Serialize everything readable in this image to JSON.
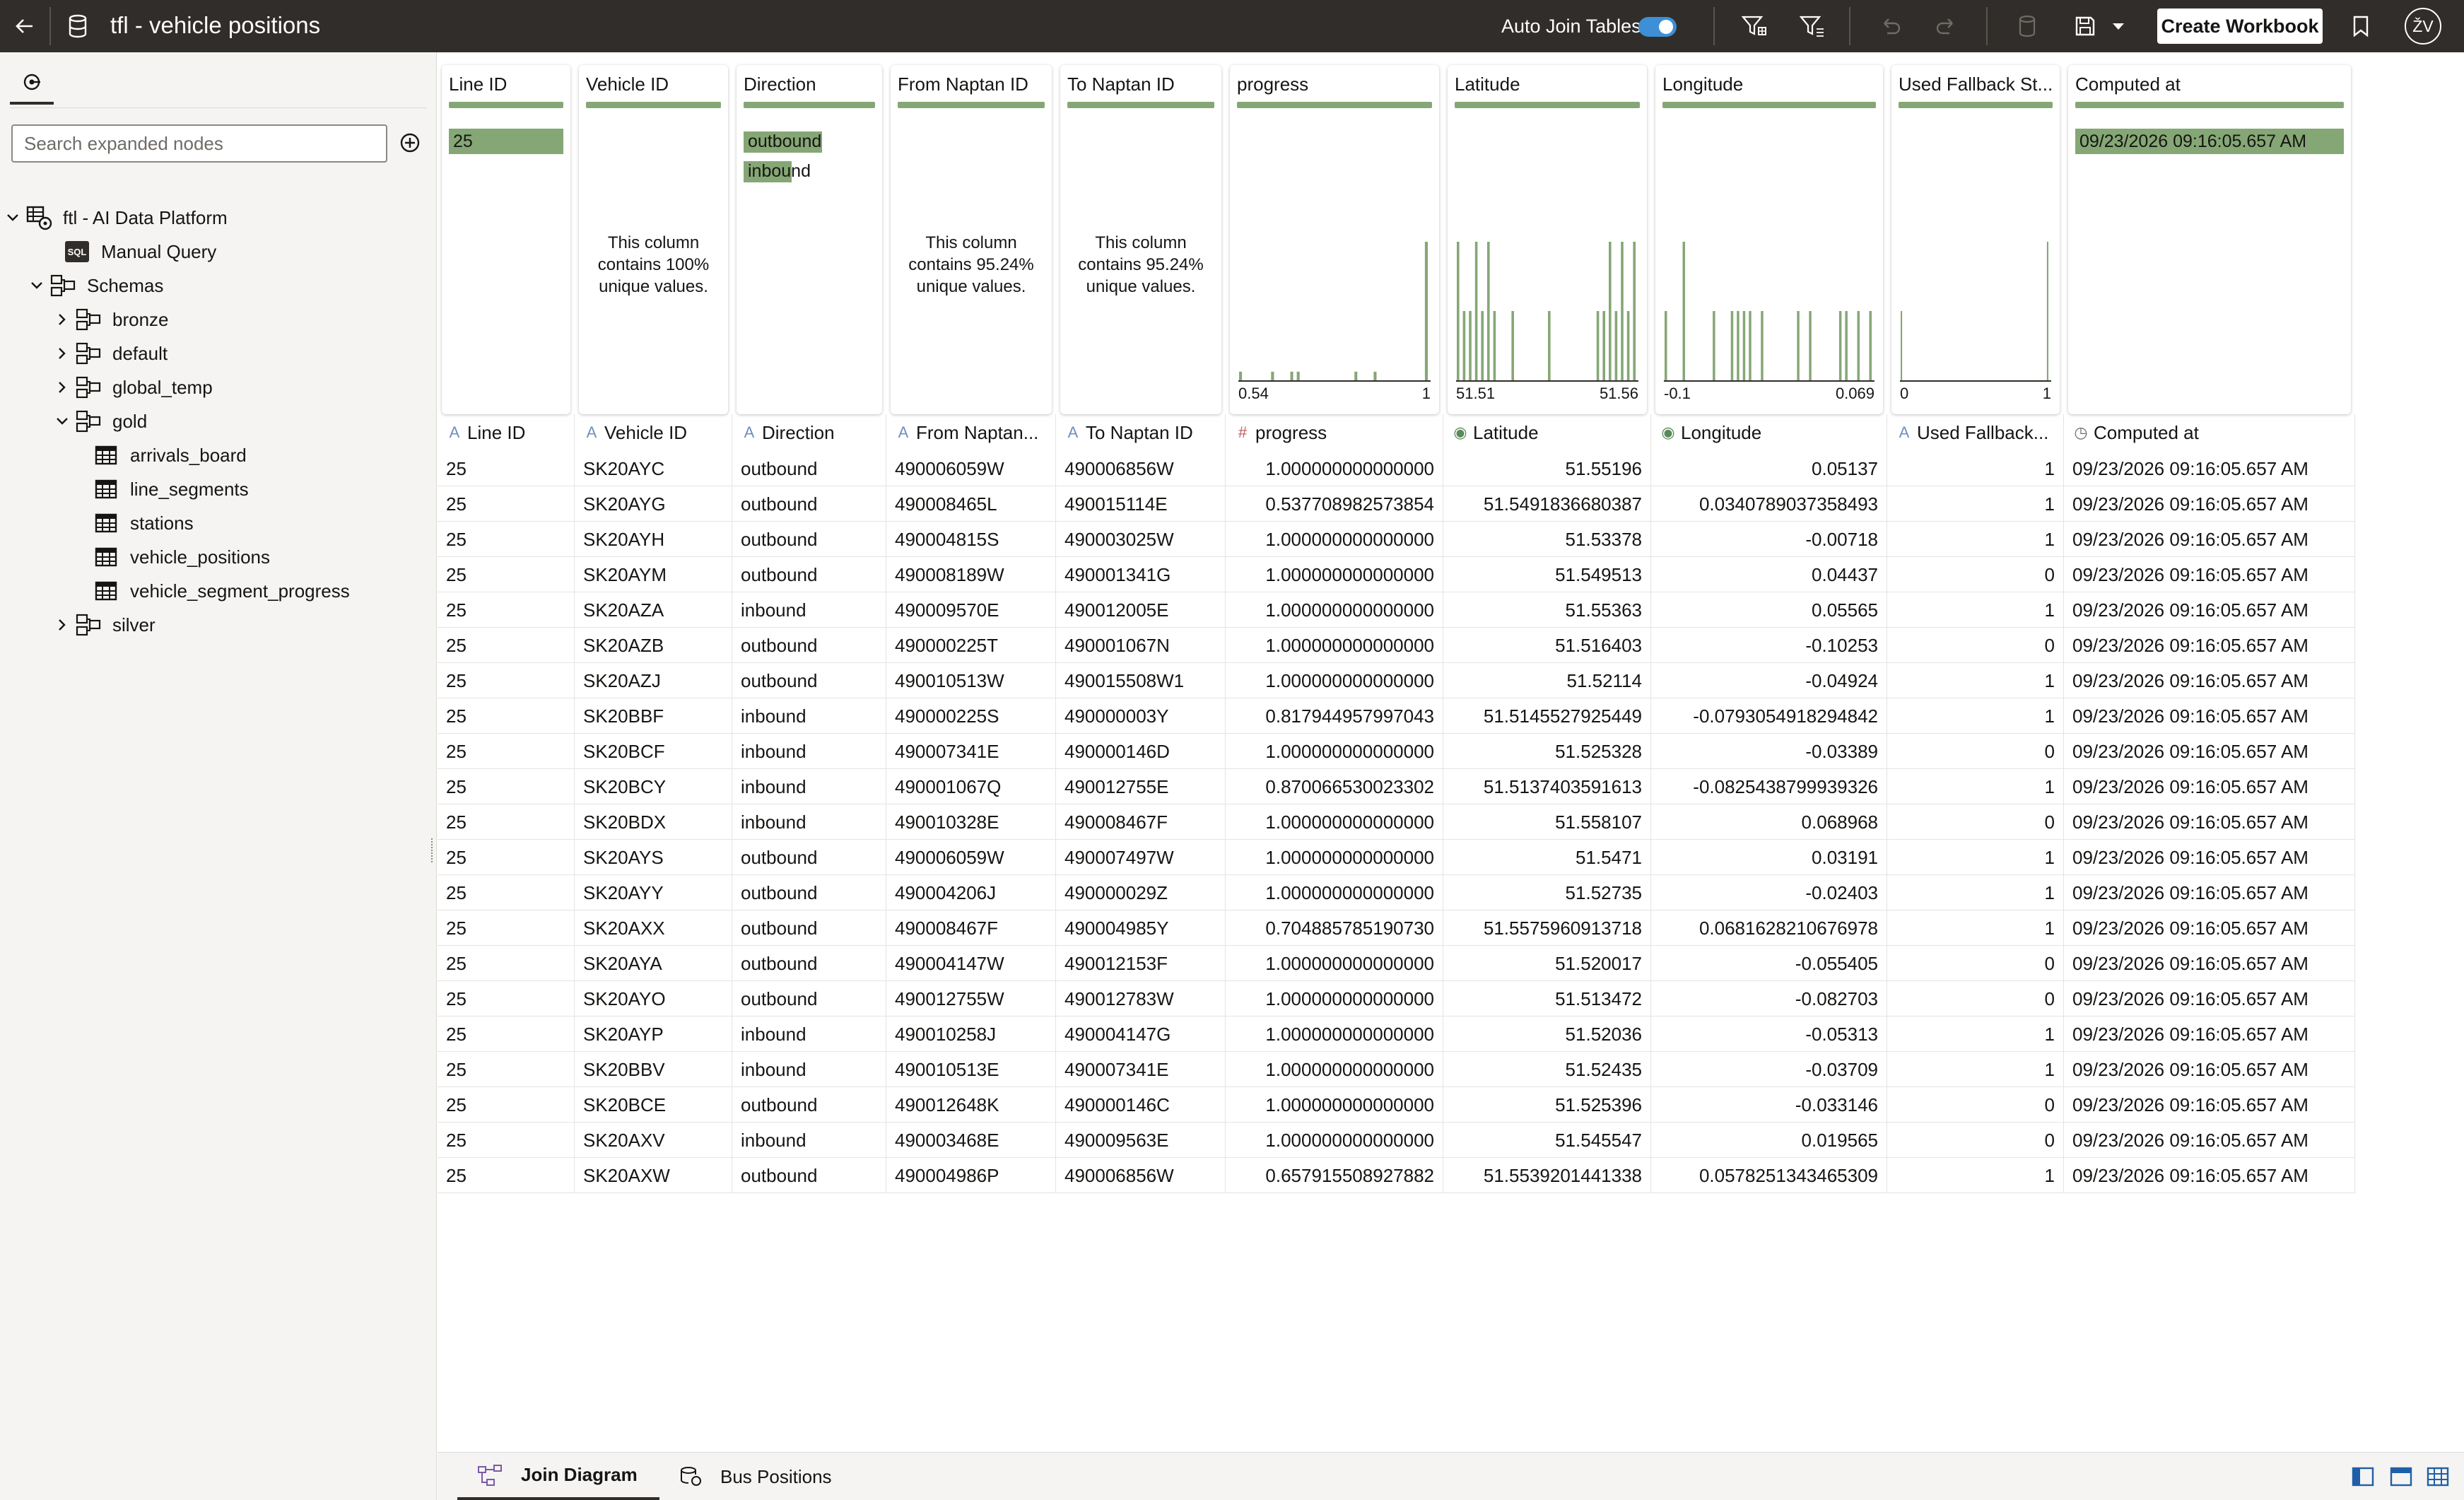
{
  "header": {
    "title": "tfl - vehicle positions",
    "auto_join_label": "Auto Join Tables",
    "auto_join_on": true,
    "create_workbook_label": "Create Workbook",
    "user_initials": "ŽV"
  },
  "sidebar": {
    "search_placeholder": "Search expanded nodes",
    "tree": [
      {
        "label": "ftl - AI Data Platform",
        "icon": "database-platform-icon",
        "chevron": "expanded",
        "level": 0
      },
      {
        "label": "Manual Query",
        "icon": "sql-icon",
        "chevron": "none",
        "level": 1
      },
      {
        "label": "Schemas",
        "icon": "schema-icon",
        "chevron": "expanded",
        "level": 1
      },
      {
        "label": "bronze",
        "icon": "schema-icon",
        "chevron": "collapsed",
        "level": 2
      },
      {
        "label": "default",
        "icon": "schema-icon",
        "chevron": "collapsed",
        "level": 2
      },
      {
        "label": "global_temp",
        "icon": "schema-icon",
        "chevron": "collapsed",
        "level": 2
      },
      {
        "label": "gold",
        "icon": "schema-icon",
        "chevron": "expanded",
        "level": 2
      },
      {
        "label": "arrivals_board",
        "icon": "table-icon",
        "chevron": "none",
        "level": 3
      },
      {
        "label": "line_segments",
        "icon": "table-icon",
        "chevron": "none",
        "level": 3
      },
      {
        "label": "stations",
        "icon": "table-icon",
        "chevron": "none",
        "level": 3
      },
      {
        "label": "vehicle_positions",
        "icon": "table-icon",
        "chevron": "none",
        "level": 3
      },
      {
        "label": "vehicle_segment_progress",
        "icon": "table-icon",
        "chevron": "none",
        "level": 3
      },
      {
        "label": "silver",
        "icon": "schema-icon",
        "chevron": "collapsed",
        "level": 2
      }
    ]
  },
  "profiles": [
    {
      "title": "Line ID",
      "kind": "chip",
      "chip": "25"
    },
    {
      "title": "Vehicle ID",
      "kind": "message",
      "message": "This column contains 100% unique values."
    },
    {
      "title": "Direction",
      "kind": "categories",
      "categories": [
        {
          "label": "outbound",
          "fraction": 0.62
        },
        {
          "label": "inbound",
          "fraction": 0.38
        }
      ]
    },
    {
      "title": "From Naptan ID",
      "kind": "message",
      "message": "This column contains 95.24% unique values."
    },
    {
      "title": "To Naptan ID",
      "kind": "message",
      "message": "This column contains 95.24% unique values."
    },
    {
      "title": "progress",
      "kind": "histogram",
      "min": "0.54",
      "max": "1",
      "bins": [
        1,
        0,
        0,
        0,
        0,
        1,
        0,
        0,
        1,
        1,
        0,
        0,
        0,
        0,
        0,
        0,
        0,
        0,
        1,
        0,
        0,
        1,
        0,
        0,
        0,
        0,
        0,
        0,
        0,
        16
      ]
    },
    {
      "title": "Latitude",
      "kind": "histogram",
      "min": "51.51",
      "max": "51.56",
      "bins": [
        2,
        1,
        1,
        2,
        1,
        2,
        1,
        0,
        0,
        1,
        0,
        0,
        0,
        0,
        0,
        1,
        0,
        0,
        0,
        0,
        0,
        0,
        0,
        1,
        1,
        2,
        1,
        2,
        1,
        2
      ]
    },
    {
      "title": "Longitude",
      "kind": "histogram",
      "min": "-0.1",
      "max": "0.069",
      "bins": [
        1,
        0,
        0,
        2,
        0,
        0,
        0,
        0,
        1,
        0,
        0,
        1,
        1,
        1,
        1,
        0,
        1,
        0,
        0,
        0,
        0,
        0,
        1,
        0,
        1,
        0,
        0,
        0,
        0,
        1,
        1,
        0,
        1,
        0,
        1
      ]
    },
    {
      "title": "Used Fallback St...",
      "kind": "histogram",
      "min": "0",
      "max": "1",
      "bins": [
        7,
        0,
        0,
        0,
        0,
        0,
        0,
        0,
        0,
        0,
        0,
        0,
        0,
        0,
        0,
        0,
        0,
        0,
        0,
        0,
        0,
        0,
        0,
        0,
        0,
        0,
        0,
        0,
        0,
        14
      ]
    },
    {
      "title": "Computed at",
      "kind": "chip",
      "chip": "09/23/2026 09:16:05.657 AM"
    }
  ],
  "columns": [
    {
      "label": "Line ID",
      "type_icon": "text-type-icon",
      "align": "left"
    },
    {
      "label": "Vehicle ID",
      "type_icon": "text-type-icon",
      "align": "left"
    },
    {
      "label": "Direction",
      "type_icon": "text-type-icon",
      "align": "left"
    },
    {
      "label": "From Naptan...",
      "type_icon": "text-type-icon",
      "align": "left"
    },
    {
      "label": "To Naptan ID",
      "type_icon": "text-type-icon",
      "align": "left"
    },
    {
      "label": "progress",
      "type_icon": "number-type-icon",
      "align": "right"
    },
    {
      "label": "Latitude",
      "type_icon": "geo-type-icon",
      "align": "right"
    },
    {
      "label": "Longitude",
      "type_icon": "geo-type-icon",
      "align": "right"
    },
    {
      "label": "Used Fallback...",
      "type_icon": "text-type-icon",
      "align": "right"
    },
    {
      "label": "Computed at",
      "type_icon": "datetime-type-icon",
      "align": "left"
    }
  ],
  "rows": [
    [
      "25",
      "SK20AYC",
      "outbound",
      "490006059W",
      "490006856W",
      "1.000000000000000",
      "51.55196",
      "0.05137",
      "1",
      "09/23/2026 09:16:05.657 AM"
    ],
    [
      "25",
      "SK20AYG",
      "outbound",
      "490008465L",
      "490015114E",
      "0.537708982573854",
      "51.5491836680387",
      "0.0340789037358493",
      "1",
      "09/23/2026 09:16:05.657 AM"
    ],
    [
      "25",
      "SK20AYH",
      "outbound",
      "490004815S",
      "490003025W",
      "1.000000000000000",
      "51.53378",
      "-0.00718",
      "1",
      "09/23/2026 09:16:05.657 AM"
    ],
    [
      "25",
      "SK20AYM",
      "outbound",
      "490008189W",
      "490001341G",
      "1.000000000000000",
      "51.549513",
      "0.04437",
      "0",
      "09/23/2026 09:16:05.657 AM"
    ],
    [
      "25",
      "SK20AZA",
      "inbound",
      "490009570E",
      "490012005E",
      "1.000000000000000",
      "51.55363",
      "0.05565",
      "1",
      "09/23/2026 09:16:05.657 AM"
    ],
    [
      "25",
      "SK20AZB",
      "outbound",
      "490000225T",
      "490001067N",
      "1.000000000000000",
      "51.516403",
      "-0.10253",
      "0",
      "09/23/2026 09:16:05.657 AM"
    ],
    [
      "25",
      "SK20AZJ",
      "outbound",
      "490010513W",
      "490015508W1",
      "1.000000000000000",
      "51.52114",
      "-0.04924",
      "1",
      "09/23/2026 09:16:05.657 AM"
    ],
    [
      "25",
      "SK20BBF",
      "inbound",
      "490000225S",
      "490000003Y",
      "0.817944957997043",
      "51.5145527925449",
      "-0.0793054918294842",
      "1",
      "09/23/2026 09:16:05.657 AM"
    ],
    [
      "25",
      "SK20BCF",
      "inbound",
      "490007341E",
      "490000146D",
      "1.000000000000000",
      "51.525328",
      "-0.03389",
      "0",
      "09/23/2026 09:16:05.657 AM"
    ],
    [
      "25",
      "SK20BCY",
      "inbound",
      "490001067Q",
      "490012755E",
      "0.870066530023302",
      "51.5137403591613",
      "-0.0825438799939326",
      "1",
      "09/23/2026 09:16:05.657 AM"
    ],
    [
      "25",
      "SK20BDX",
      "inbound",
      "490010328E",
      "490008467F",
      "1.000000000000000",
      "51.558107",
      "0.068968",
      "0",
      "09/23/2026 09:16:05.657 AM"
    ],
    [
      "25",
      "SK20AYS",
      "outbound",
      "490006059W",
      "490007497W",
      "1.000000000000000",
      "51.5471",
      "0.03191",
      "1",
      "09/23/2026 09:16:05.657 AM"
    ],
    [
      "25",
      "SK20AYY",
      "outbound",
      "490004206J",
      "490000029Z",
      "1.000000000000000",
      "51.52735",
      "-0.02403",
      "1",
      "09/23/2026 09:16:05.657 AM"
    ],
    [
      "25",
      "SK20AXX",
      "outbound",
      "490008467F",
      "490004985Y",
      "0.704885785190730",
      "51.5575960913718",
      "0.0681628210676978",
      "1",
      "09/23/2026 09:16:05.657 AM"
    ],
    [
      "25",
      "SK20AYA",
      "outbound",
      "490004147W",
      "490012153F",
      "1.000000000000000",
      "51.520017",
      "-0.055405",
      "0",
      "09/23/2026 09:16:05.657 AM"
    ],
    [
      "25",
      "SK20AYO",
      "outbound",
      "490012755W",
      "490012783W",
      "1.000000000000000",
      "51.513472",
      "-0.082703",
      "0",
      "09/23/2026 09:16:05.657 AM"
    ],
    [
      "25",
      "SK20AYP",
      "inbound",
      "490010258J",
      "490004147G",
      "1.000000000000000",
      "51.52036",
      "-0.05313",
      "1",
      "09/23/2026 09:16:05.657 AM"
    ],
    [
      "25",
      "SK20BBV",
      "inbound",
      "490010513E",
      "490007341E",
      "1.000000000000000",
      "51.52435",
      "-0.03709",
      "1",
      "09/23/2026 09:16:05.657 AM"
    ],
    [
      "25",
      "SK20BCE",
      "outbound",
      "490012648K",
      "490000146C",
      "1.000000000000000",
      "51.525396",
      "-0.033146",
      "0",
      "09/23/2026 09:16:05.657 AM"
    ],
    [
      "25",
      "SK20AXV",
      "inbound",
      "490003468E",
      "490009563E",
      "1.000000000000000",
      "51.545547",
      "0.019565",
      "0",
      "09/23/2026 09:16:05.657 AM"
    ],
    [
      "25",
      "SK20AXW",
      "outbound",
      "490004986P",
      "490006856W",
      "0.657915508927882",
      "51.5539201441338",
      "0.0578251343465309",
      "1",
      "09/23/2026 09:16:05.657 AM"
    ]
  ],
  "bottom_tabs": [
    {
      "label": "Join Diagram",
      "active": true
    },
    {
      "label": "Bus Positions",
      "active": false
    }
  ],
  "colors": {
    "accent_green": "#85a775",
    "topbar": "#312d2a",
    "toggle_blue": "#3d8fd6"
  }
}
